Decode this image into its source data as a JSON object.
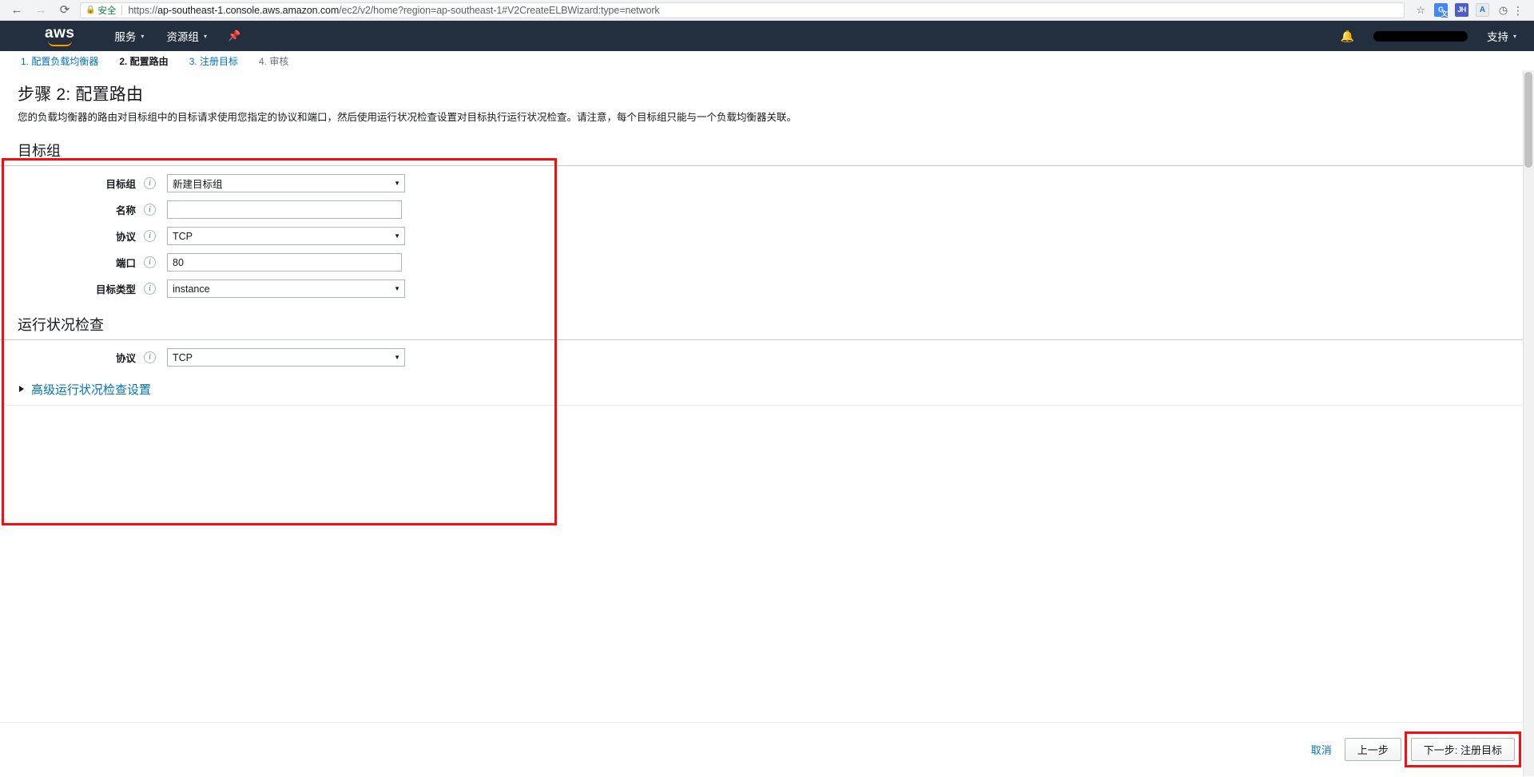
{
  "browser": {
    "back_icon": "←",
    "forward_icon": "→",
    "reload_icon": "⟳",
    "secure_label": "安全",
    "lock_icon": "🔒",
    "url_scheme": "https://",
    "url_host": "ap-southeast-1.console.aws.amazon.com",
    "url_path": "/ec2/v2/home?region=ap-southeast-1#V2CreateELBWizard:type=network",
    "star_icon": "☆",
    "extensions": [
      {
        "name": "google-translate",
        "glyph": "G"
      },
      {
        "name": "jh-extension",
        "glyph": "JH"
      },
      {
        "name": "document-scanner",
        "glyph": "A"
      },
      {
        "name": "screen-recorder",
        "glyph": "📹"
      }
    ],
    "menu_icon": "⋮"
  },
  "awsnav": {
    "logo_text": "aws",
    "services_label": "服务",
    "resource_groups_label": "资源组",
    "pin_icon": "📌",
    "bell_icon": "🔔",
    "account_label": "",
    "support_label": "支持",
    "caret": "▾"
  },
  "steps": [
    {
      "label": "1. 配置负载均衡器",
      "state": "link"
    },
    {
      "label": "2. 配置路由",
      "state": "current"
    },
    {
      "label": "3. 注册目标",
      "state": "link"
    },
    {
      "label": "4. 审核",
      "state": "muted"
    }
  ],
  "page": {
    "title": "步骤 2: 配置路由",
    "description": "您的负载均衡器的路由对目标组中的目标请求使用您指定的协议和端口，然后使用运行状况检查设置对目标执行运行状况检查。请注意，每个目标组只能与一个负载均衡器关联。"
  },
  "target_group_section": {
    "heading": "目标组",
    "fields": {
      "target_group": {
        "label": "目标组",
        "value": "新建目标组",
        "type": "select",
        "info_icon": "i"
      },
      "name": {
        "label": "名称",
        "value": "",
        "placeholder": "",
        "type": "text",
        "info_icon": "i"
      },
      "protocol": {
        "label": "协议",
        "value": "TCP",
        "type": "select",
        "info_icon": "i"
      },
      "port": {
        "label": "端口",
        "value": "80",
        "type": "text",
        "info_icon": "i"
      },
      "target_type": {
        "label": "目标类型",
        "value": "instance",
        "type": "select",
        "info_icon": "i"
      }
    },
    "caret_icon": "▼"
  },
  "health_check_section": {
    "heading": "运行状况检查",
    "fields": {
      "protocol": {
        "label": "协议",
        "value": "TCP",
        "type": "select",
        "info_icon": "i"
      }
    },
    "advanced_toggle_label": "高级运行状况检查设置",
    "advanced_expanded": false,
    "triangle_icon": "▶"
  },
  "footer": {
    "cancel_label": "取消",
    "previous_label": "上一步",
    "next_label": "下一步: 注册目标"
  },
  "annotations": {
    "accent_color": "#fb0b0b",
    "boxes": [
      "step-2-form-panel",
      "next-register-targets-button"
    ]
  }
}
